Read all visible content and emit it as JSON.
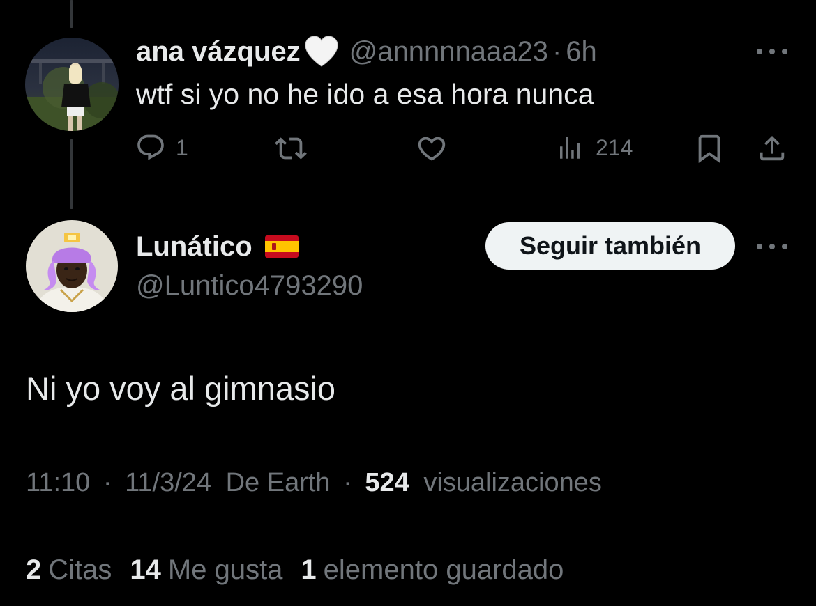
{
  "reply_tweet": {
    "display_name": "ana vázquez",
    "name_emoji": "white-heart-icon",
    "handle": "@annnnnaaa23",
    "separator": "·",
    "time": "6h",
    "text": "wtf si yo no he ido a esa hora nunca",
    "actions": {
      "reply_count": "1",
      "retweet_count": "",
      "like_count": "",
      "views_count": "214"
    }
  },
  "main_tweet": {
    "display_name": "Lunático",
    "name_emoji": "spain-flag-icon",
    "handle": "@Luntico4793290",
    "follow_button_label": "Seguir también",
    "text": "Ni yo voy al gimnasio",
    "meta": {
      "time": "11:10",
      "date": "11/3/24",
      "source": "De Earth",
      "views_count": "524",
      "views_label": "visualizaciones",
      "separator": "·"
    },
    "stats": {
      "quotes_count": "2",
      "quotes_label": "Citas",
      "likes_count": "14",
      "likes_label": "Me gusta",
      "bookmarks_count": "1",
      "bookmarks_label": "elemento guardado"
    }
  },
  "colors": {
    "background": "#000000",
    "text_primary": "#e7e9ea",
    "text_secondary": "#71767b",
    "divider": "#2f3336",
    "button_bg": "#eff3f4"
  }
}
